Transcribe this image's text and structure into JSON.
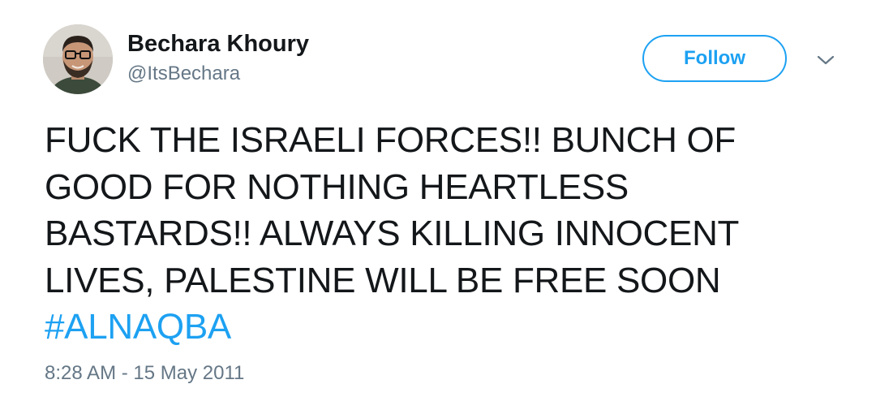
{
  "user": {
    "display_name": "Bechara Khoury",
    "handle": "@ItsBechara"
  },
  "actions": {
    "follow_label": "Follow",
    "menu_icon": "chevron-down-icon"
  },
  "tweet": {
    "lines": [
      "FUCK THE ISRAELI FORCES!! BUNCH OF",
      "GOOD FOR NOTHING HEARTLESS",
      "BASTARDS!! ALWAYS KILLING INNOCENT",
      "LIVES, PALESTINE WILL BE FREE SOON"
    ],
    "hashtag": "#ALNAQBA",
    "timestamp": "8:28 AM - 15 May 2011"
  },
  "colors": {
    "accent": "#1da1f2",
    "text": "#14171a",
    "secondary": "#657786"
  }
}
